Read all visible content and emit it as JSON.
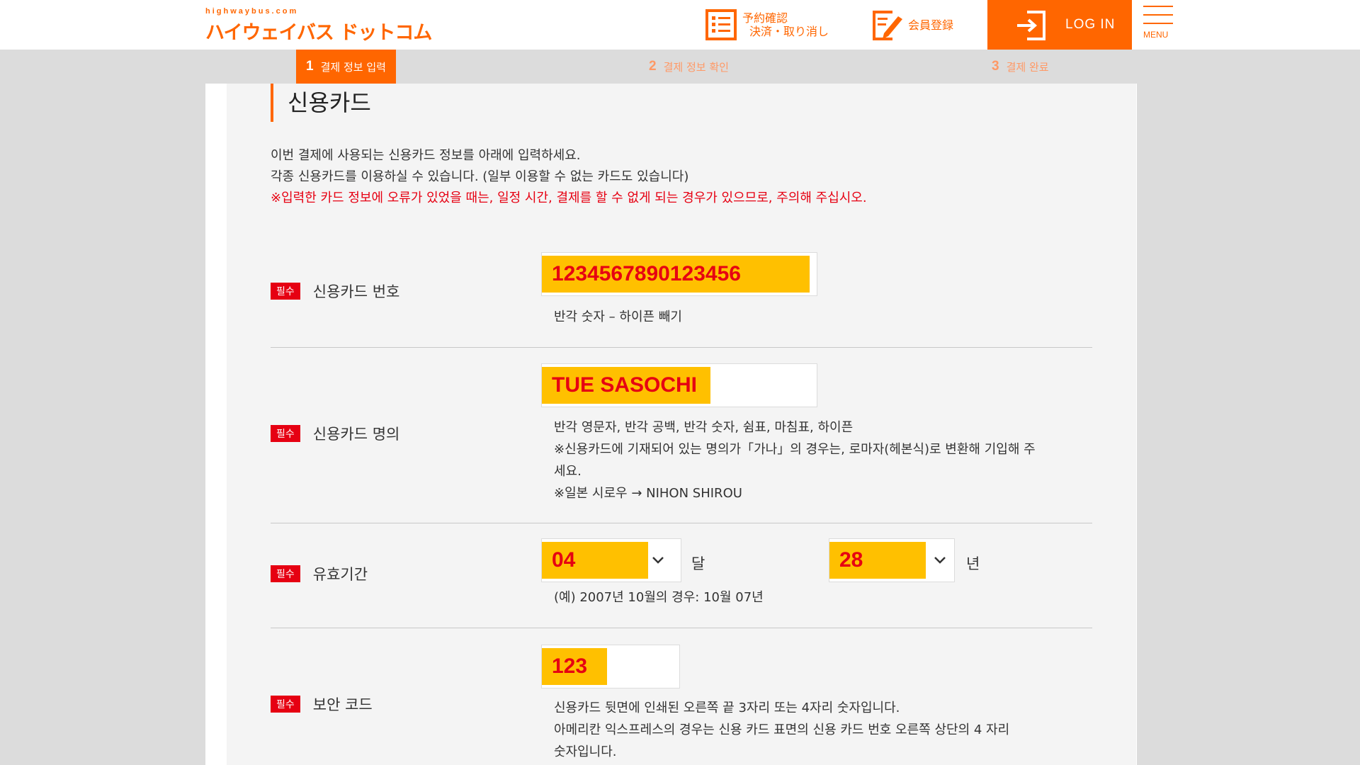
{
  "header": {
    "logo_small": "highwaybus.com",
    "logo_big": "ハイウェイバス ドットコム",
    "reserve_label_1": "予約確認",
    "reserve_label_2": "決済・取り消し",
    "member_label": "会員登録",
    "login_label": "LOG IN",
    "menu_label": "MENU",
    "accent": "#ff6600"
  },
  "steps": [
    {
      "num": "1",
      "label": "결제 정보 입력"
    },
    {
      "num": "2",
      "label": "결제 정보 확인"
    },
    {
      "num": "3",
      "label": "결제 완료"
    }
  ],
  "section": {
    "title": "신용카드",
    "intro_1": "이번 결제에 사용되는 신용카드 정보를 아래에 입력하세요.",
    "intro_2": "각종 신용카드를 이용하실 수 있습니다. (일부 이용할 수 없는 카드도 있습니다)",
    "warning": "※입력한 카드 정보에 오류가 있었을 때는, 일정 시간, 결제를 할 수 없게 되는 경우가 있으므로, 주의해 주십시오."
  },
  "required_badge": "필수",
  "card_number": {
    "label": "신용카드 번호",
    "value": "1234567890123456",
    "hint": "반각 숫자 – 하이픈 빼기"
  },
  "card_holder": {
    "label": "신용카드 명의",
    "value": "TUE SASOCHI",
    "hint_1": "반각 영문자, 반각 공백, 반각 숫자, 쉼표, 마침표, 하이픈",
    "hint_2": "※신용카드에 기재되어 있는 명의가「가나」의 경우는, 로마자(헤본식)로 변환해 기입해 주",
    "hint_3": "세요.",
    "hint_4": "※일본 시로우 → NIHON SHIROU"
  },
  "expiry": {
    "label": "유효기간",
    "month_value": "04",
    "month_unit": "달",
    "year_value": "28",
    "year_unit": "년",
    "hint": "(예) 2007년 10월의 경우: 10월 07년"
  },
  "security_code": {
    "label": "보안 코드",
    "value": "123",
    "hint_1": "신용카드 뒷면에 인쇄된 오른쪽 끝 3자리 또는 4자리 숫자입니다.",
    "hint_2": "아메리칸 익스프레스의 경우는 신용 카드 표면의 신용 카드 번호 오른쪽 상단의 4 자리",
    "hint_3": "숫자입니다."
  }
}
